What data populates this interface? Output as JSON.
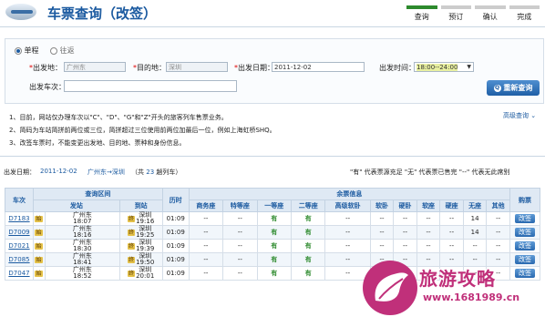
{
  "header": {
    "title": "车票查询（改签）",
    "steps": [
      {
        "label": "查询",
        "active": true
      },
      {
        "label": "预订",
        "active": false
      },
      {
        "label": "确认",
        "active": false
      },
      {
        "label": "完成",
        "active": false
      }
    ]
  },
  "form": {
    "trip_type": {
      "one_way": "单程",
      "round_trip": "往返",
      "selected": "单程"
    },
    "from_label": "出发地：",
    "from_value": "广州东",
    "to_label": "目的地：",
    "to_value": "深圳",
    "date_label": "出发日期：",
    "date_value": "2011-12-02",
    "time_label": "出发时间：",
    "time_value": "18:00--24:00",
    "train_label": "出发车次：",
    "train_value": "",
    "query_button": "重新查询",
    "advanced_query": "高级查询"
  },
  "notes": [
    "1、目前，网站仅办理车次以\"C\"、\"D\"、\"G\"和\"Z\"开头的旅客列车售票业务。",
    "2、简码为车站简拼前两位或三位，简拼超过三位使用前两位加最后一位，例如上海虹桥SHQ。",
    "3、改签车票时，不能变更出发地、目的地、票种和身份信息。"
  ],
  "result_summary": {
    "date_label": "出发日期：",
    "date": "2011-12-02",
    "route": "广州东→深圳",
    "count_prefix": "（共",
    "count": "23",
    "count_suffix": "趟列车）",
    "legend": "\"有\" 代表票源充足 \"无\" 代表票已售完 \"--\" 代表无此席别"
  },
  "table": {
    "headers": {
      "train": "车次",
      "section": "查询区间",
      "depart": "发站",
      "arrive": "到站",
      "duration": "历时",
      "seats": "余票信息",
      "book": "购票"
    },
    "seat_types": [
      "商务座",
      "特等座",
      "一等座",
      "二等座",
      "高级软卧",
      "软卧",
      "硬卧",
      "软座",
      "硬座",
      "无座",
      "其他"
    ],
    "start_badge": "始",
    "end_badge": "终",
    "book_label": "改签",
    "rows": [
      {
        "train": "D7183",
        "from": "广州东",
        "dep": "18:07",
        "to": "深圳",
        "arr": "19:16",
        "duration": "01:09",
        "seats": [
          "--",
          "--",
          "有",
          "有",
          "--",
          "--",
          "--",
          "--",
          "--",
          "14",
          "--"
        ]
      },
      {
        "train": "D7009",
        "from": "广州东",
        "dep": "18:16",
        "to": "深圳",
        "arr": "19:25",
        "duration": "01:09",
        "seats": [
          "--",
          "--",
          "有",
          "有",
          "--",
          "--",
          "--",
          "--",
          "--",
          "14",
          "--"
        ]
      },
      {
        "train": "D7021",
        "from": "广州东",
        "dep": "18:30",
        "to": "深圳",
        "arr": "19:39",
        "duration": "01:09",
        "seats": [
          "--",
          "--",
          "有",
          "有",
          "--",
          "--",
          "--",
          "--",
          "--",
          "--",
          "--"
        ]
      },
      {
        "train": "D7085",
        "from": "广州东",
        "dep": "18:41",
        "to": "深圳",
        "arr": "19:50",
        "duration": "01:09",
        "seats": [
          "--",
          "--",
          "有",
          "有",
          "--",
          "--",
          "--",
          "--",
          "--",
          "--",
          "--"
        ]
      },
      {
        "train": "D7047",
        "from": "广州东",
        "dep": "18:52",
        "to": "深圳",
        "arr": "20:01",
        "duration": "01:09",
        "seats": [
          "--",
          "--",
          "有",
          "有",
          "--",
          "--",
          "--",
          "--",
          "--",
          "--",
          "--"
        ]
      }
    ]
  },
  "watermark": {
    "title": "旅游攻略",
    "url": "www.1681989.cn"
  }
}
